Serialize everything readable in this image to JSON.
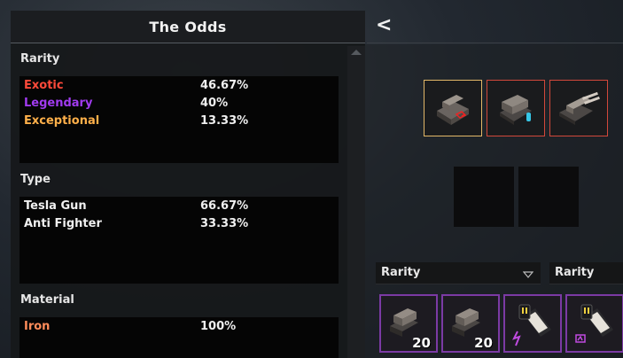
{
  "odds": {
    "title": "The Odds",
    "sections": {
      "rarity": {
        "title": "Rarity",
        "rows": [
          {
            "name": "Exotic",
            "pct": "46.67%",
            "color": "#ff4a3a"
          },
          {
            "name": "Legendary",
            "pct": "40%",
            "color": "#a13bf0"
          },
          {
            "name": "Exceptional",
            "pct": "13.33%",
            "color": "#ffb04a"
          }
        ]
      },
      "type": {
        "title": "Type",
        "rows": [
          {
            "name": "Tesla Gun",
            "pct": "66.67%",
            "color": "#f0f0f0"
          },
          {
            "name": "Anti Fighter",
            "pct": "33.33%",
            "color": "#f0f0f0"
          }
        ]
      },
      "material": {
        "title": "Material",
        "rows": [
          {
            "name": "Iron",
            "pct": "100%",
            "color": "#ff8c5a"
          }
        ]
      }
    }
  },
  "right": {
    "back_label": "<",
    "preview_slots": [
      {
        "icon": "turret-red-accent-icon",
        "border_color": "#e3b868"
      },
      {
        "icon": "turret-cyan-accent-icon",
        "border_color": "#d2483b"
      },
      {
        "icon": "turret-twin-barrel-icon",
        "border_color": "#d2483b"
      }
    ],
    "dropdowns": [
      {
        "label": "Rarity",
        "caret": "▽"
      },
      {
        "label": "Rarity"
      }
    ],
    "inventory": [
      {
        "icon": "turret-icon",
        "qty": "20"
      },
      {
        "icon": "turret-icon",
        "qty": "20"
      },
      {
        "icon": "tesla-module-icon",
        "qty": ""
      },
      {
        "icon": "tesla-module-icon",
        "qty": ""
      }
    ],
    "accent_color": "#7b3aa4"
  }
}
